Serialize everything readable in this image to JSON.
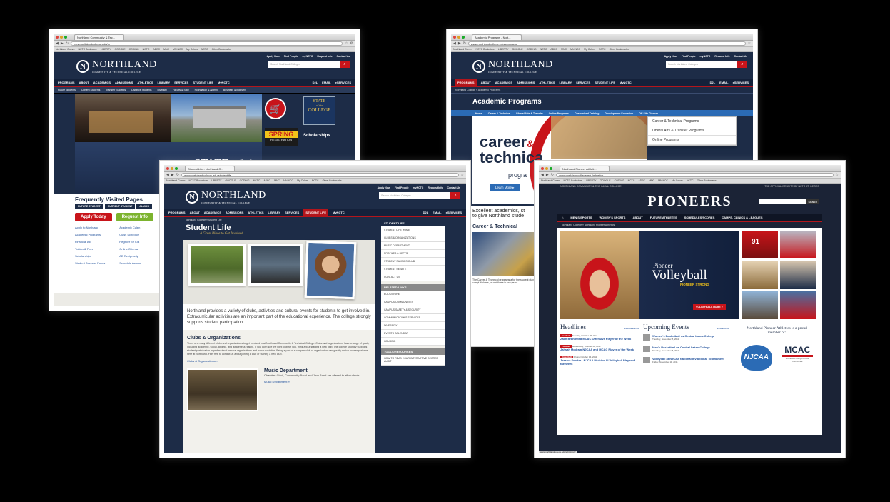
{
  "w1": {
    "tab": "Northland Community & Tec...",
    "url": "www.northlandcollege.edu/nr",
    "bookmarks": [
      "Northland Comm",
      "NCTC Bookstore",
      "LIBERTY",
      "GOOGLE",
      "CODING",
      "NCTC",
      "ADEC",
      "MNC",
      "MN NCC",
      "My Colors",
      "NCTC",
      "Other Bookmarks"
    ],
    "logo": "NORTHLAND",
    "logo_sub": "COMMUNITY & TECHNICAL COLLEGE",
    "util_links": [
      "Apply Now",
      "Find People",
      "myNCTC",
      "Request Info",
      "Contact Us"
    ],
    "search_placeholder": "Search Northland Colleges",
    "nav": [
      "PROGRAMS",
      "ABOUT",
      "ACADEMICS",
      "ADMISSIONS",
      "ATHLETICS",
      "LIBRARY",
      "SERVICES",
      "STUDENT LIFE",
      "MyNCTC"
    ],
    "nav_right": [
      "D2L",
      "EMAIL",
      "eSERVICES"
    ],
    "subnav": [
      "Future Students",
      "Current Students",
      "Transfer Students",
      "Distance Students",
      "Diversity",
      "Faculty & Staff",
      "Foundation & Alumni",
      "Business & Industry"
    ],
    "hero_title": "STATE of th",
    "hero_sub": "Wednesday, November",
    "promo_state": [
      "STATE",
      "of the",
      "COLLEGE"
    ],
    "promo_spring": "SPRING",
    "promo_spring_sub": "REGISTRATION",
    "promo_scholar": "Scholarships",
    "fvp_title": "Frequently Visited Pages",
    "fvp_tabs": [
      "FUTURE STUDENT",
      "CURRENT STUDENT",
      "ALUMNI"
    ],
    "apply_btn": "Apply Today",
    "request_btn": "Request Info",
    "links_left": [
      "Apply to Northland",
      "Academic Programs",
      "Financial Aid",
      "Tuition & Fees",
      "Scholarships",
      "Student Success Points"
    ],
    "links_right": [
      "Academic Calen",
      "Class Schedule",
      "Register for Cla",
      "Online Orientat",
      "AD Reciprocity",
      "Schedule Assess"
    ]
  },
  "w2": {
    "tab": "Academic Programs - Nort...",
    "url": "www.northlandcollege.edu/programs",
    "logo": "NORTHLAND",
    "logo_sub": "COMMUNITY & TECHNICAL COLLEGE",
    "util_links": [
      "Apply Now",
      "Find People",
      "myNCTC",
      "Request Info",
      "Contact Us"
    ],
    "search_placeholder": "Search Northland Colleges",
    "nav": [
      "PROGRAMS",
      "ABOUT",
      "ACADEMICS",
      "ADMISSIONS",
      "ATHLETICS",
      "LIBRARY",
      "SERVICES",
      "STUDENT LIFE",
      "MyNCTC"
    ],
    "nav_right": [
      "D2L",
      "EMAIL",
      "eSERVICES"
    ],
    "crumb": "Northland College » Academic Programs",
    "page_title": "Academic Programs",
    "subnav": [
      "Home",
      "Career & Technical",
      "Liberal Arts & Transfer",
      "Online Programs",
      "Customized Training",
      "Development Education",
      "Off-Site Classes"
    ],
    "dropdown": [
      "Career & Technical Programs",
      "Liberal Arts & Transfer Programs",
      "Online Programs"
    ],
    "hero_word1": "career",
    "hero_amp": "&",
    "hero_word2": "technica",
    "hero_word3": "progra",
    "learn_more": "Learn More",
    "body_text1": "Excellent academics, st",
    "body_text2": "to give Northland stude",
    "section_title": "Career & Technical",
    "small_text": "The Career & Technical programs a for the student planning to compl diploma, or certificate in two years"
  },
  "w3": {
    "tab": "Student Life - Northland C...",
    "url": "www.northlandcollege.edu/studentlife",
    "logo": "NORTHLAND",
    "logo_sub": "COMMUNITY & TECHNICAL COLLEGE",
    "util_links": [
      "Apply Now",
      "Find People",
      "myNCTC",
      "Request Info",
      "Contact Us"
    ],
    "search_placeholder": "Search Northland Colleges",
    "nav": [
      "PROGRAMS",
      "ABOUT",
      "ACADEMICS",
      "ADMISSIONS",
      "ATHLETICS",
      "LIBRARY",
      "SERVICES",
      "STUDENT LIFE",
      "MyNCTC"
    ],
    "nav_right": [
      "D2L",
      "EMAIL",
      "eSERVICES"
    ],
    "crumb": "Northland College » Student Life",
    "page_title": "Student Life",
    "tagline": "A Great Place to Get Involved",
    "intro": "Northland provides a variety of clubs, activities and cultural events for students to get involved in. Extracurricular activities are an important part of the educational experience. The college strongly supports student participation.",
    "clubs_title": "Clubs & Organizations",
    "clubs_text": "There are many different clubs and organizations to get involved in at Northland Community & Technical College. Clubs and organizations have a range of goals, including academic, social, athletic, and awareness raising. If you don't see the right club for you, think about starting a new club. The college strongly supports student participation in professional service organizations and honor societies. Being a part of a campus club or organization can greatly enrich your experience here at Northland. Feel free to contact us about joining a club or starting a new club.",
    "clubs_link": "Clubs & Organizations »",
    "music_title": "Music Department",
    "music_text": "Chamber Choir, Community Band and Jazz Band are offered to all students.",
    "music_link": "Music Department »",
    "side_title": "STUDENT LIFE",
    "side_items": [
      "STUDENT LIFE HOME",
      "CLUBS & ORGANIZATIONS",
      "MUSIC DEPARTMENT",
      "PROFILES & DEPTS",
      "STUDENT SAVINGS CLUB",
      "STUDENT SENATE",
      "CONTACT US"
    ],
    "related_title": "RELATED LINKS",
    "related_items": [
      "BOOKSTORE",
      "CAMPUS COMMUNITIES",
      "CAMPUS SAFETY & SECURITY",
      "COMMUNICATIONS SERVICES",
      "DIVERSITY",
      "EVENTS CALENDAR",
      "HOUSING"
    ],
    "tools_title": "TOOLS/RESOURCES",
    "tools_items": [
      "HOW TO READ YOUR INTERACTIVE DEGREE AUDIT"
    ]
  },
  "w4": {
    "tab": "Northland Pioneer Athleti...",
    "url": "www.northlandcollege.edu/athletics",
    "top_left": "NORTHLAND COMMUNITY & TECHNICAL COLLEGE",
    "top_right": "THE OFFICIAL WEBSITE OF NCTC ATHLETICS",
    "brand": "PIONEERS",
    "search_btn": "Search",
    "nav": [
      "MEN'S SPORTS",
      "WOMEN'S SPORTS",
      "ABOUT",
      "FUTURE ATHLETES",
      "SCHEDULES/SCORES",
      "CAMPS, CLINICS & LEAGUES"
    ],
    "crumb": "Northland College » Northland Pioneer Athletics",
    "hero_small": "Pioneer",
    "hero_big": "Volleyball",
    "hero_tag": "PIONEER STRONG",
    "hero_btn": "VOLLEYBALL HOME »",
    "jersey": "91",
    "headlines_title": "Headlines",
    "headlines_all": "View Headlines",
    "headlines": [
      {
        "badge": "Football",
        "date": "Tuesday, October 25, 2011",
        "title": "Zach Brandsted MCAC Offensive Player of the Week"
      },
      {
        "badge": "Football",
        "date": "Wednesday, October 19, 2011",
        "title": "Jahsah Mcdrain NJCAA and MCAC Player of the Week"
      },
      {
        "badge": "Volleyball",
        "date": "Friday, October 14, 2011",
        "title": "Jessica Fonder - NJCAA Division III Volleyball Player of the Week"
      }
    ],
    "events_title": "Upcoming Events",
    "events_all": "View Events",
    "events": [
      {
        "title": "Women's Basketball vs Central Lakes College",
        "date": "Tuesday, November 8, 2011"
      },
      {
        "title": "Men's Basketball vs Central Lakes College",
        "date": "Tuesday, November 8, 2011"
      },
      {
        "title": "Volleyball at NJCAA National Invitational Tournament",
        "date": "Friday, November 11, 2011"
      }
    ],
    "member_text": "Northland Pioneer Athletics is a proud member of:",
    "njcaa": "NJCAA",
    "mcac": "MCAC",
    "mcac_sub": "Minnesota College Athletic Conference",
    "status": "www.northlandcollege.edu/athletics/#"
  },
  "colors": {
    "navy": "#1d2c47",
    "red": "#c8141a",
    "green": "#7cb32e",
    "blue_sub": "#2b6bb5"
  }
}
